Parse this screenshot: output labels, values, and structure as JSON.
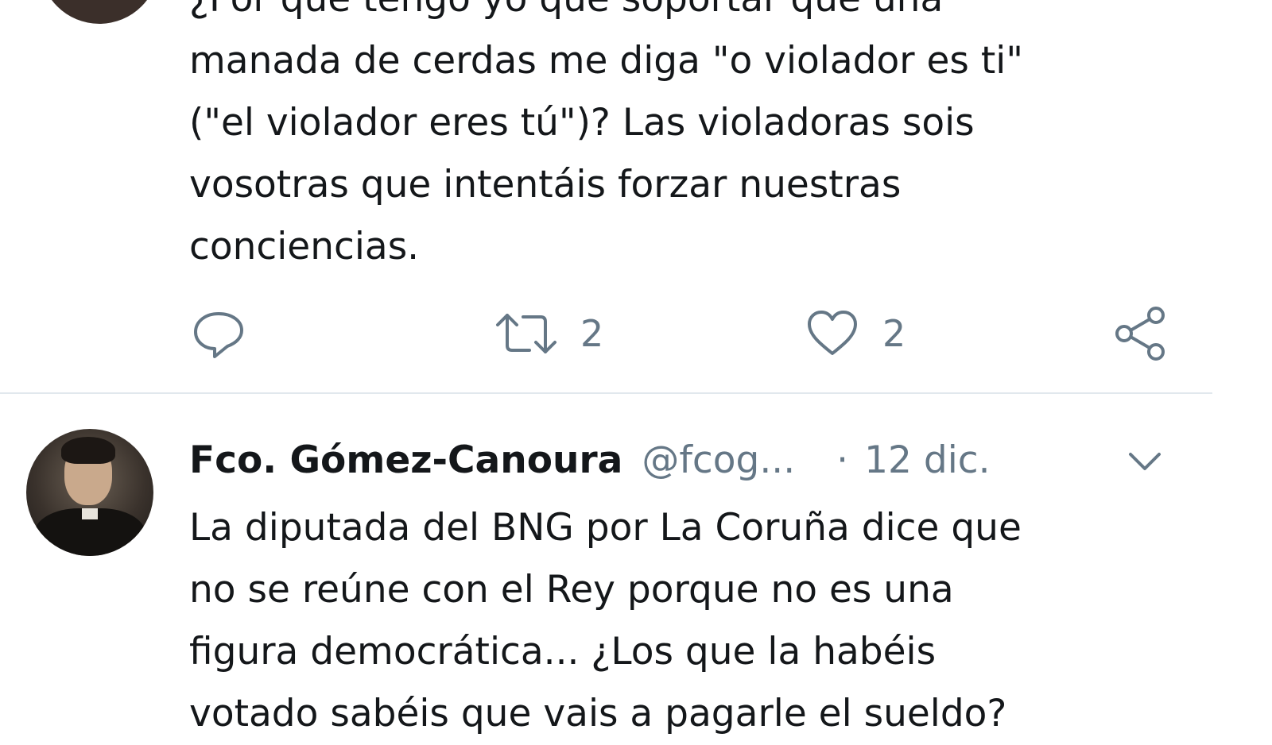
{
  "tweet1": {
    "lines": [
      "¿Por qué tengo yo que soportar que una",
      "manada de cerdas me diga \"o violador es ti\"",
      "(\"el violador eres tú\")? Las violadoras sois",
      "vosotras que intentáis forzar nuestras",
      "conciencias."
    ],
    "actions": {
      "reply_icon": "reply-icon",
      "retweet_icon": "retweet-icon",
      "retweet_count": "2",
      "like_icon": "heart-icon",
      "like_count": "2",
      "share_icon": "share-icon"
    }
  },
  "tweet2": {
    "display_name": "Fco. Gómez-Canoura",
    "handle": "@fcog...",
    "separator": "·",
    "date": "12 dic.",
    "menu_icon": "chevron-down-icon",
    "lines": [
      "La diputada del BNG por La Coruña dice que",
      "no se reúne con el Rey porque no es una",
      "figura democrática... ¿Los que la habéis",
      "votado sabéis que vais a pagarle el sueldo?"
    ]
  },
  "colors": {
    "text": "#14171a",
    "secondary": "#657786",
    "divider": "#e1e8ed"
  }
}
